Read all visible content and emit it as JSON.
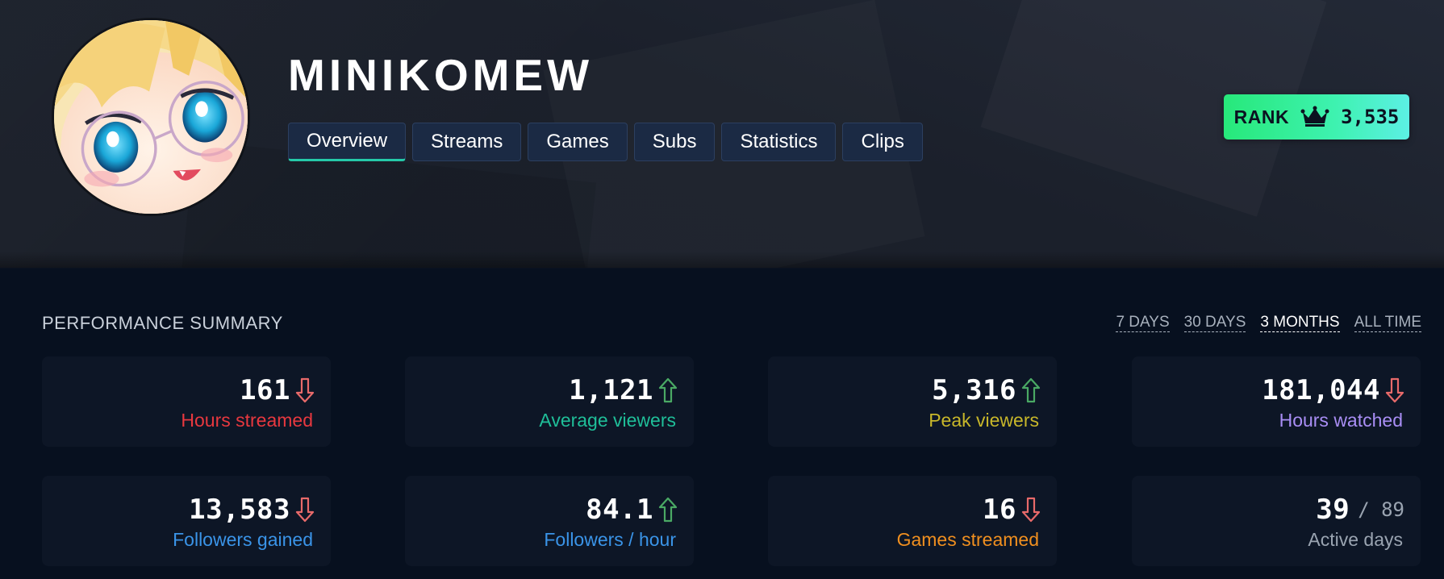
{
  "channel": {
    "name": "MINIKOMEW"
  },
  "tabs": [
    {
      "label": "Overview",
      "active": true
    },
    {
      "label": "Streams",
      "active": false
    },
    {
      "label": "Games",
      "active": false
    },
    {
      "label": "Subs",
      "active": false
    },
    {
      "label": "Statistics",
      "active": false
    },
    {
      "label": "Clips",
      "active": false
    }
  ],
  "rank": {
    "label": "RANK",
    "value": "3,535",
    "icon": "crown-icon"
  },
  "summary": {
    "title": "PERFORMANCE SUMMARY",
    "periods": [
      {
        "label": "7 DAYS",
        "active": false
      },
      {
        "label": "30 DAYS",
        "active": false
      },
      {
        "label": "3 MONTHS",
        "active": true
      },
      {
        "label": "ALL TIME",
        "active": false
      }
    ],
    "cards": [
      {
        "value": "161",
        "label": "Hours streamed",
        "trend": "down",
        "label_color": "#e8383f"
      },
      {
        "value": "1,121",
        "label": "Average viewers",
        "trend": "up",
        "label_color": "#1fbf99"
      },
      {
        "value": "5,316",
        "label": "Peak viewers",
        "trend": "up",
        "label_color": "#c8b72a"
      },
      {
        "value": "181,044",
        "label": "Hours watched",
        "trend": "down",
        "label_color": "#a98ef5"
      },
      {
        "value": "13,583",
        "label": "Followers gained",
        "trend": "down",
        "label_color": "#3a94e8"
      },
      {
        "value": "84.1",
        "label": "Followers / hour",
        "trend": "up",
        "label_color": "#3a94e8"
      },
      {
        "value": "16",
        "label": "Games streamed",
        "trend": "down",
        "label_color": "#f08f1f"
      },
      {
        "value": "39",
        "sub": "/ 89",
        "label": "Active days",
        "trend": "none",
        "label_color": "#9aa4b1"
      }
    ]
  },
  "colors": {
    "trend_up": "#4aa964",
    "trend_down": "#e86a6a",
    "accent": "#25c9a9"
  }
}
